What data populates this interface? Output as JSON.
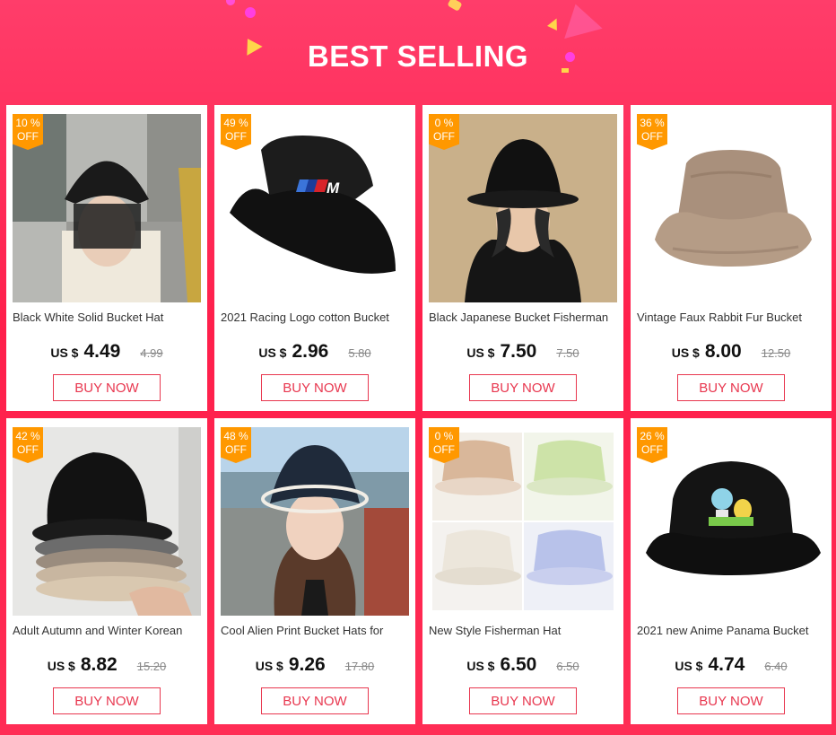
{
  "header": {
    "title": "BEST SELLING"
  },
  "colors": {
    "background": "#ff2d55",
    "badge": "#ff9800",
    "buy_border": "#e8374f"
  },
  "products": [
    {
      "discount": "10 %",
      "off": "OFF",
      "name": "Black White Solid Bucket Hat",
      "currency": "US $",
      "price": "4.49",
      "old_price": "4.99",
      "buy": "BUY NOW"
    },
    {
      "discount": "49 %",
      "off": "OFF",
      "name": "2021 Racing Logo cotton Bucket",
      "currency": "US $",
      "price": "2.96",
      "old_price": "5.80",
      "buy": "BUY NOW"
    },
    {
      "discount": "0 %",
      "off": "OFF",
      "name": "Black Japanese Bucket Fisherman",
      "currency": "US $",
      "price": "7.50",
      "old_price": "7.50",
      "buy": "BUY NOW"
    },
    {
      "discount": "36 %",
      "off": "OFF",
      "name": "Vintage Faux Rabbit Fur Bucket",
      "currency": "US $",
      "price": "8.00",
      "old_price": "12.50",
      "buy": "BUY NOW"
    },
    {
      "discount": "42 %",
      "off": "OFF",
      "name": "Adult Autumn and Winter Korean",
      "currency": "US $",
      "price": "8.82",
      "old_price": "15.20",
      "buy": "BUY NOW"
    },
    {
      "discount": "48 %",
      "off": "OFF",
      "name": "Cool Alien Print Bucket Hats for",
      "currency": "US $",
      "price": "9.26",
      "old_price": "17.80",
      "buy": "BUY NOW"
    },
    {
      "discount": "0 %",
      "off": "OFF",
      "name": "New Style Fisherman Hat",
      "currency": "US $",
      "price": "6.50",
      "old_price": "6.50",
      "buy": "BUY NOW"
    },
    {
      "discount": "26 %",
      "off": "OFF",
      "name": "2021 new Anime Panama Bucket",
      "currency": "US $",
      "price": "4.74",
      "old_price": "6.40",
      "buy": "BUY NOW"
    }
  ]
}
